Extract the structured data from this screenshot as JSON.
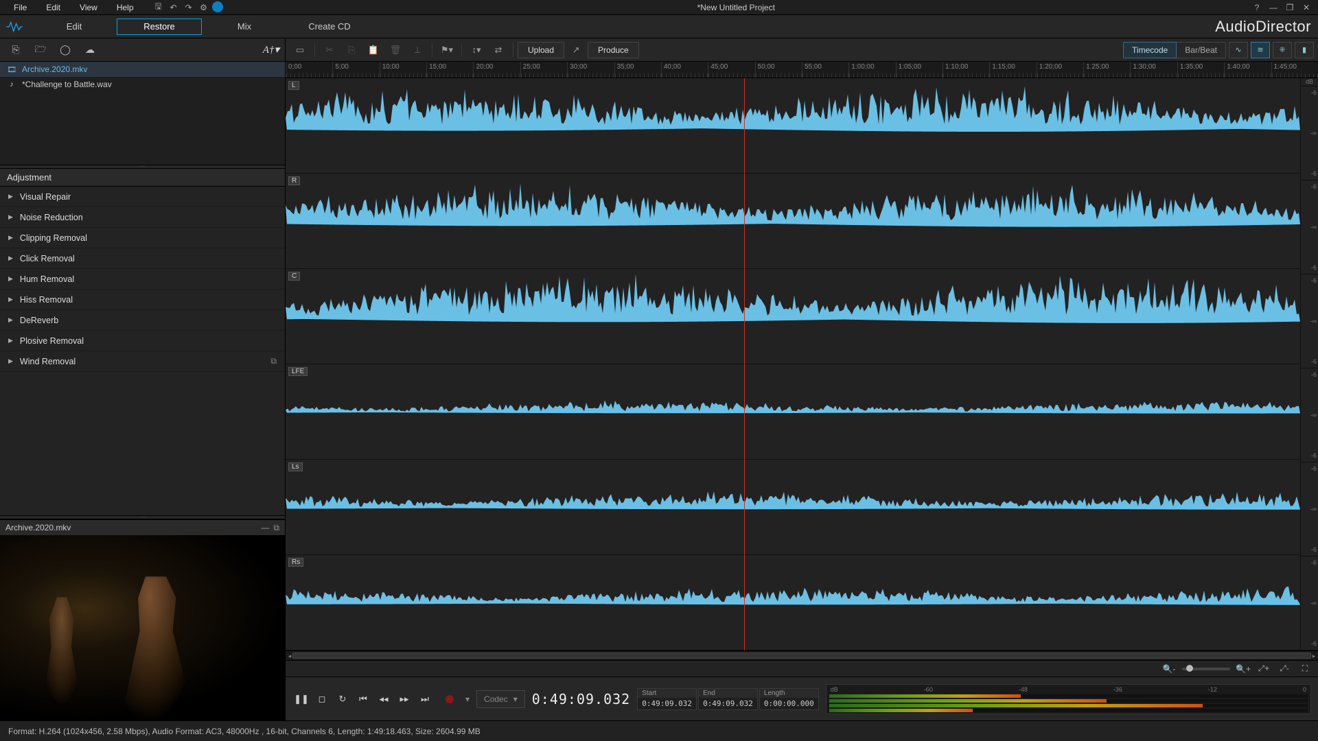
{
  "window": {
    "title": "*New Untitled Project",
    "brand": "AudioDirector"
  },
  "menu": [
    "File",
    "Edit",
    "View",
    "Help"
  ],
  "modes": [
    {
      "label": "Edit",
      "active": false
    },
    {
      "label": "Restore",
      "active": true
    },
    {
      "label": "Mix",
      "active": false
    },
    {
      "label": "Create CD",
      "active": false
    }
  ],
  "left_toolbar_font": "A†▾",
  "media": [
    {
      "icon": "video-icon",
      "name": "Archive.2020.mkv",
      "selected": true
    },
    {
      "icon": "audio-icon",
      "name": "*Challenge to Battle.wav",
      "selected": false
    }
  ],
  "adjustment": {
    "title": "Adjustment",
    "items": [
      "Visual Repair",
      "Noise Reduction",
      "Clipping Removal",
      "Click Removal",
      "Hum Removal",
      "Hiss Removal",
      "DeReverb",
      "Plosive Removal",
      "Wind Removal"
    ]
  },
  "preview": {
    "title": "Archive.2020.mkv"
  },
  "main_toolbar": {
    "upload": "Upload",
    "produce": "Produce",
    "timecode": "Timecode",
    "barbeat": "Bar/Beat"
  },
  "timeline_ticks": [
    "0;00",
    "5;00",
    "10;00",
    "15;00",
    "20;00",
    "25;00",
    "30;00",
    "35;00",
    "40;00",
    "45;00",
    "50;00",
    "55;00",
    "1:00;00",
    "1:05;00",
    "1:10;00",
    "1:15;00",
    "1:20;00",
    "1:25;00",
    "1:30;00",
    "1:35;00",
    "1:40;00",
    "1:45;00"
  ],
  "channels": [
    "L",
    "R",
    "C",
    "LFE",
    "Ls",
    "Rs"
  ],
  "db_scale_header": "dB",
  "db_scale": [
    "-6",
    "-∞",
    "-6"
  ],
  "playhead_pct": 45.2,
  "transport": {
    "codec": "Codec",
    "time": "0:49:09.032",
    "range": {
      "start_lbl": "Start",
      "start": "0:49:09.032",
      "end_lbl": "End",
      "end": "0:49:09.032",
      "len_lbl": "Length",
      "len": "0:00:00.000"
    },
    "meter_scale": [
      "dB",
      "-60",
      "-48",
      "-36",
      "-12",
      "0"
    ],
    "meter_levels": [
      40,
      58,
      78,
      30
    ]
  },
  "status": "Format: H.264 (1024x456, 2.58 Mbps), Audio Format: AC3, 48000Hz , 16-bit, Channels 6, Length: 1:49:18.463, Size: 2604.99 MB"
}
